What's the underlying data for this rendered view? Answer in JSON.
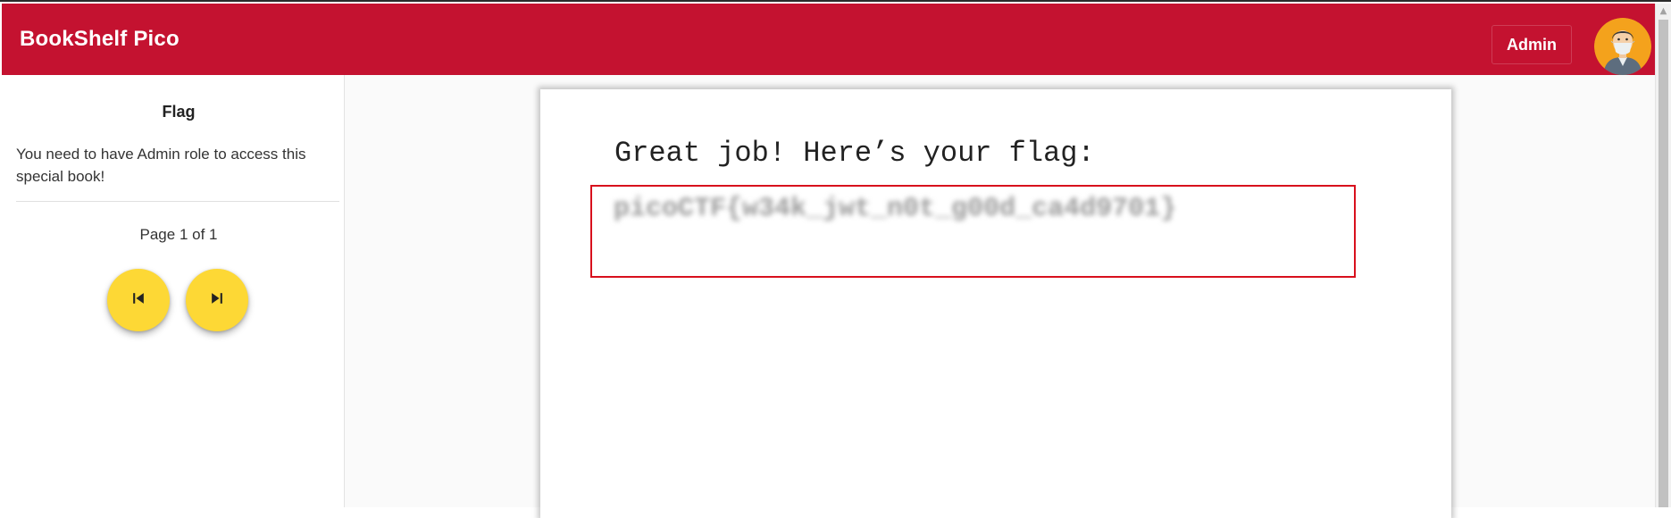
{
  "app": {
    "title": "BookShelf Pico",
    "brand_color": "#c41230"
  },
  "header": {
    "admin_label": "Admin",
    "avatar_icon": "user-avatar-icon"
  },
  "sidebar": {
    "title": "Flag",
    "message": "You need to have Admin role to access this special book!",
    "page_indicator": "Page 1 of 1",
    "prev_icon": "skip-previous-icon",
    "next_icon": "skip-next-icon",
    "nav_button_color": "#fdd835"
  },
  "book": {
    "heading": "Great job! Here’s your flag:",
    "flag": "picoCTF{w34k_jwt_n0t_g00d_ca4d9701}",
    "flag_highlight_color": "#d8101d"
  }
}
